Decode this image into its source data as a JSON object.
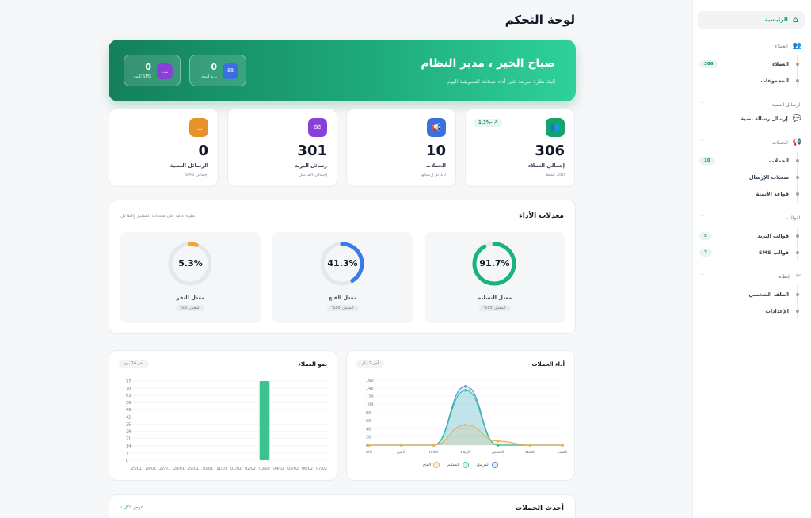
{
  "page_title": "لوحة التحكم",
  "sidebar": {
    "home": {
      "label": "الرئيسية",
      "icon": "home-icon"
    },
    "sections": [
      {
        "title": "العملاء",
        "icon": "users-icon",
        "items": [
          {
            "label": "العملاء",
            "badge": "306"
          },
          {
            "label": "المجموعات",
            "badge": ""
          }
        ]
      },
      {
        "title": "الرسائل النصية",
        "icon": "chat-icon",
        "plain": "إرسال رسالة نصية"
      },
      {
        "title": "الحملات",
        "icon": "megaphone-icon",
        "items": [
          {
            "label": "الحملات",
            "badge": "10"
          },
          {
            "label": "سجلات الإرسال",
            "badge": ""
          },
          {
            "label": "قواعد الأتمتة",
            "badge": ""
          }
        ]
      },
      {
        "title": "القوالب",
        "icon": "template-icon",
        "items": [
          {
            "label": "قوالب البريد",
            "badge": "5"
          },
          {
            "label": "قوالب SMS",
            "badge": "3"
          }
        ]
      },
      {
        "title": "النظام",
        "icon": "tools-icon",
        "items": [
          {
            "label": "الملف الشخصي",
            "badge": ""
          },
          {
            "label": "الإعدادات",
            "badge": ""
          }
        ]
      }
    ]
  },
  "hero": {
    "greeting": "صباح الخير ، مدير النظام",
    "subtitle": "إليك نظرة سريعة على أداء حملاتك التسويقية اليوم",
    "chips": [
      {
        "value": "0",
        "label": "بريد اليوم",
        "icon": "mail-icon",
        "color": "#3b6fe0"
      },
      {
        "value": "0",
        "label": "SMS اليوم",
        "icon": "sms-icon",
        "color": "#8b3fd9"
      }
    ]
  },
  "stats": [
    {
      "value": "306",
      "label": "إجمالي العملاء",
      "sub": "280 نشط",
      "trend": "↗ -1.3%",
      "icon": "users-icon",
      "color": "#13a36b"
    },
    {
      "value": "10",
      "label": "الحملات",
      "sub": "10 تم إرسالها",
      "trend": "",
      "icon": "megaphone-icon",
      "color": "#3b6fe0"
    },
    {
      "value": "301",
      "label": "رسائل البريد",
      "sub": "إجمالي المرسل",
      "trend": "",
      "icon": "mail-icon",
      "color": "#8b3fd9"
    },
    {
      "value": "0",
      "label": "الرسائل النصية",
      "sub": "إجمالي SMS",
      "trend": "",
      "icon": "sms-icon",
      "color": "#e8912a"
    }
  ],
  "performance": {
    "title": "معدلات الأداء",
    "subtitle": "نظرة عامة على معدلات التسليم والتفاعل",
    "gauges": [
      {
        "value": "91.7%",
        "fraction": 0.917,
        "label": "معدل التسليم",
        "standard": "المعيار: 95%",
        "color": "#19b47c"
      },
      {
        "value": "41.3%",
        "fraction": 0.413,
        "label": "معدل الفتح",
        "standard": "المعيار: 20%",
        "color": "#3b7be8"
      },
      {
        "value": "5.3%",
        "fraction": 0.053,
        "label": "معدل النقر",
        "standard": "المعيار: 3%",
        "color": "#f0a630"
      }
    ]
  },
  "campaign_chart": {
    "title": "أداء الحملات",
    "range": "آخر 7 أيام",
    "legend": [
      "المرسل",
      "التسليم",
      "الفتح"
    ],
    "colors": [
      "#5b8ee6",
      "#2cc79a",
      "#efb05a"
    ]
  },
  "growth_chart": {
    "title": "نمو العملاء",
    "range": "آخر 14 يوم"
  },
  "chart_data": [
    {
      "type": "line",
      "title": "أداء الحملات",
      "categories": [
        "الأحد",
        "الاثنين",
        "الثلاثاء",
        "الأربعاء",
        "الخميس",
        "الجمعة",
        "السبت"
      ],
      "series": [
        {
          "name": "المرسل",
          "values": [
            0,
            0,
            0,
            145,
            0,
            0,
            0
          ]
        },
        {
          "name": "التسليم",
          "values": [
            0,
            0,
            0,
            135,
            0,
            0,
            0
          ]
        },
        {
          "name": "الفتح",
          "values": [
            0,
            0,
            0,
            50,
            10,
            0,
            0
          ]
        }
      ],
      "ylim": [
        0,
        160
      ],
      "yticks": [
        0,
        20,
        40,
        60,
        80,
        100,
        120,
        140,
        160
      ]
    },
    {
      "type": "bar",
      "title": "نمو العملاء",
      "categories": [
        "25/01",
        "26/01",
        "27/01",
        "28/01",
        "29/01",
        "30/01",
        "31/01",
        "01/02",
        "02/02",
        "03/02",
        "04/02",
        "05/02",
        "06/02",
        "07/02"
      ],
      "values": [
        0,
        0,
        0,
        0,
        0,
        0,
        0,
        0,
        0,
        77,
        0,
        0,
        0,
        0
      ],
      "ylim": [
        0,
        77
      ],
      "yticks": [
        0,
        7,
        14,
        21,
        28,
        35,
        42,
        49,
        56,
        63,
        70,
        77
      ],
      "color": "#3cc28e"
    }
  ],
  "recent": {
    "title": "أحدث الحملات",
    "view_all": "عرض الكل"
  }
}
